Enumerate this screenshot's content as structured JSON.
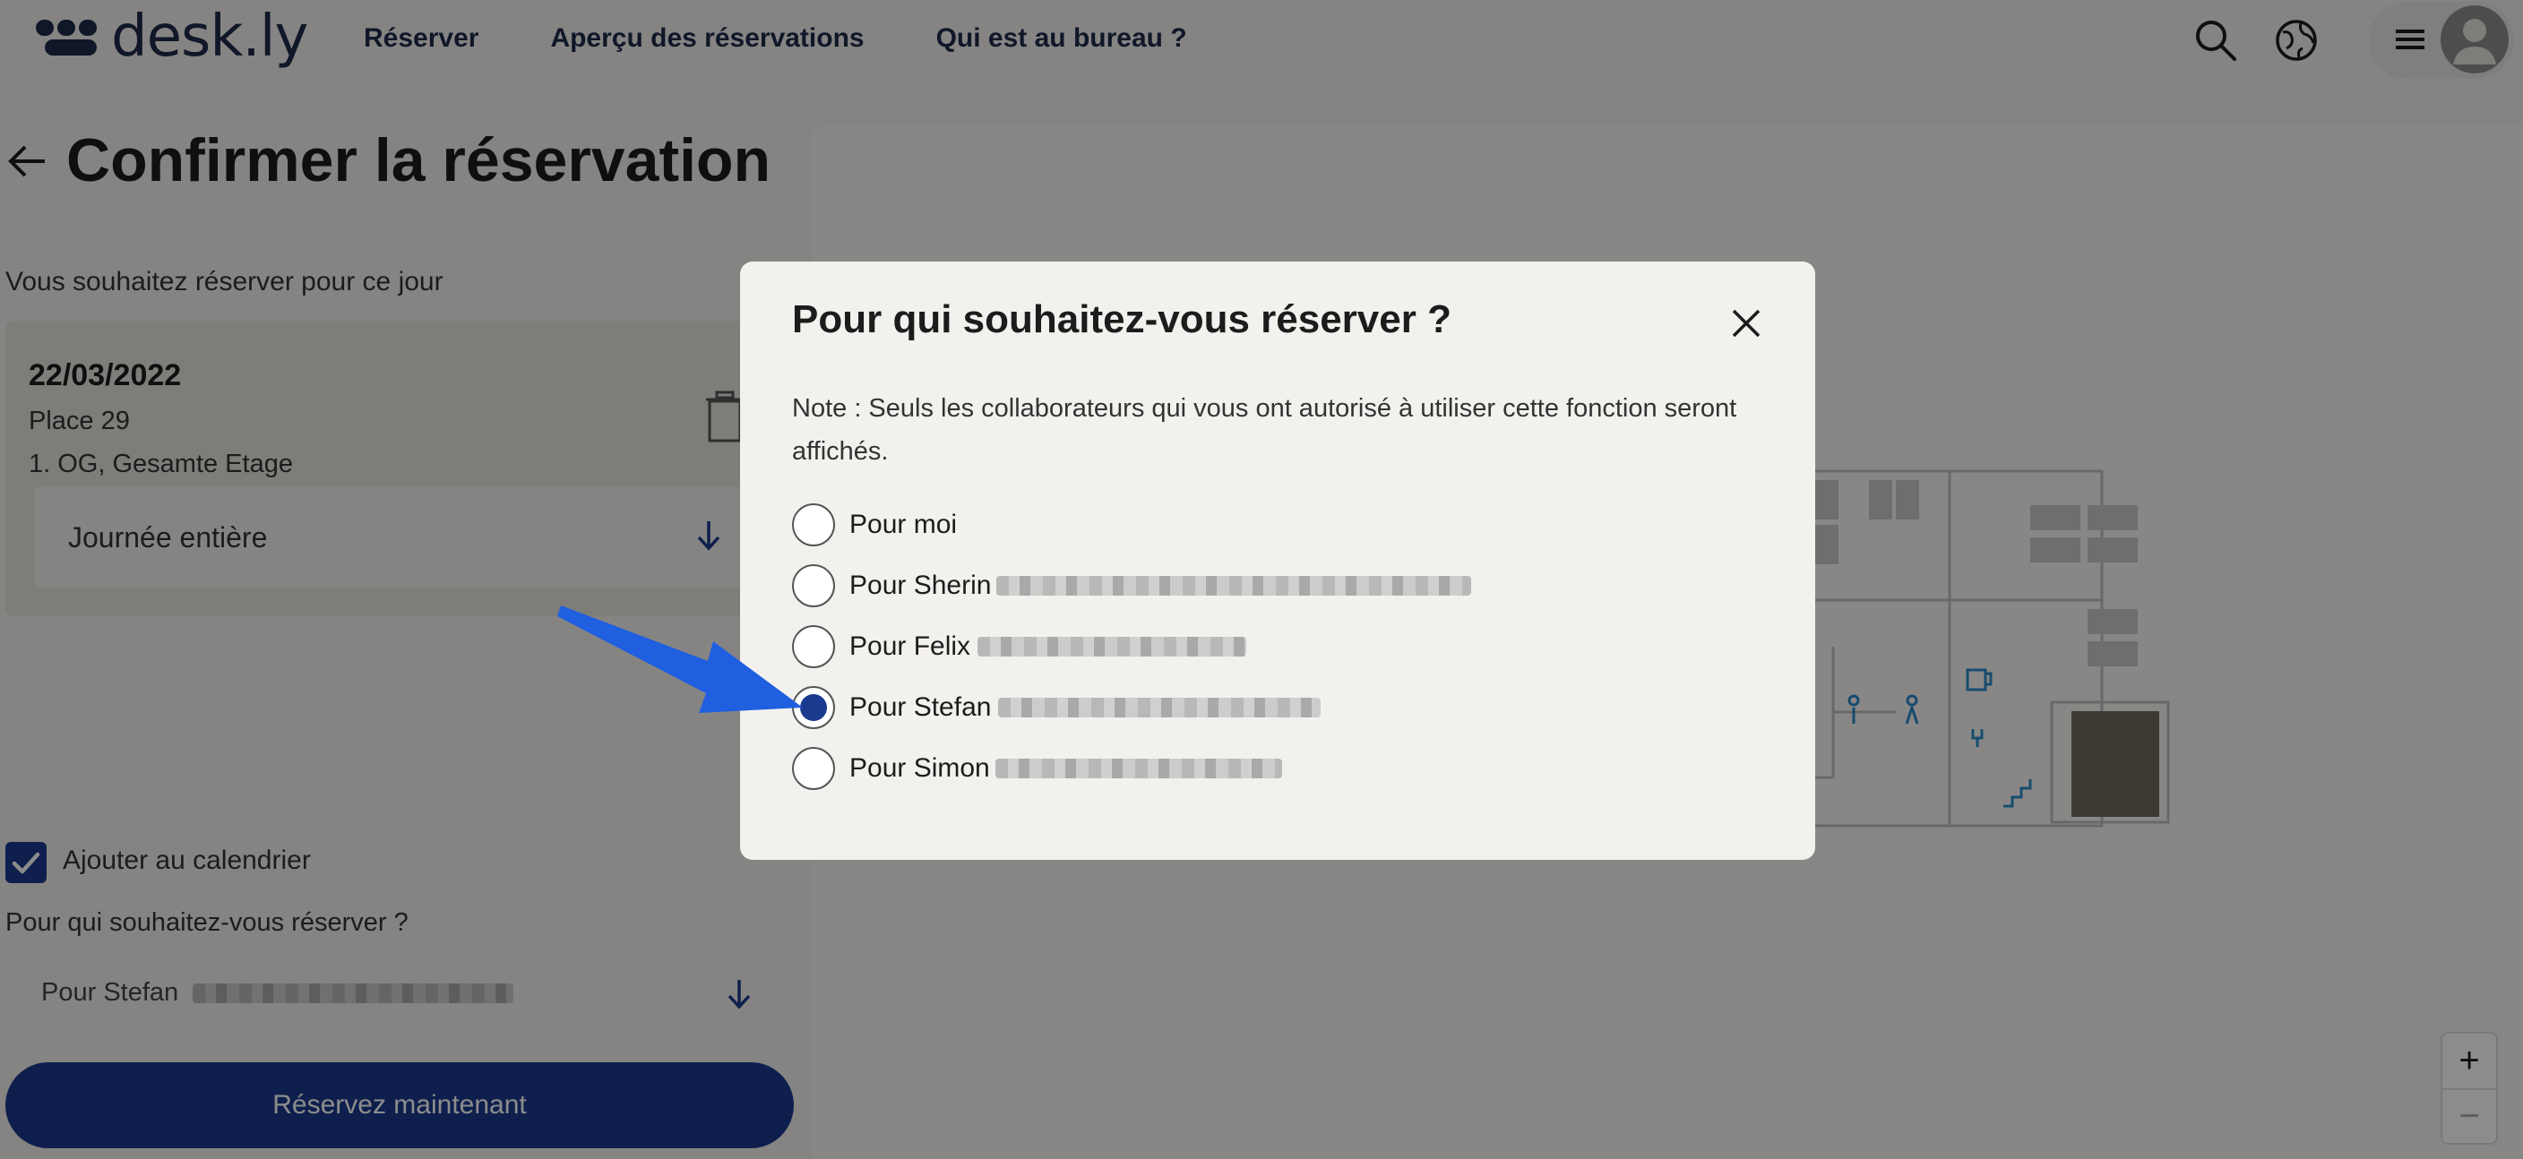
{
  "brand": {
    "name": "desk.ly"
  },
  "nav": [
    "Réserver",
    "Aperçu des réservations",
    "Qui est au bureau ?"
  ],
  "page": {
    "title": "Confirmer la réservation",
    "date_prompt": "Vous souhaitez réserver pour ce jour",
    "booking": {
      "date": "22/03/2022",
      "place": "Place 29",
      "floor": "1. OG, Gesamte Etage",
      "duration": "Journée entière"
    },
    "calendar_label": "Ajouter au calendrier",
    "calendar_checked": true,
    "for_whom_label": "Pour qui souhaitez-vous réserver ?",
    "for_whom_value": "Pour Stefan",
    "reserve_button": "Réservez maintenant"
  },
  "zoom": {
    "plus": "+",
    "minus": "−"
  },
  "modal": {
    "title": "Pour qui souhaitez-vous réserver ?",
    "note": "Note : Seuls les collaborateurs qui vous ont autorisé à utiliser cette fonction seront affichés.",
    "options": [
      {
        "label": "Pour moi",
        "checked": false
      },
      {
        "label": "Pour Sherin",
        "checked": false
      },
      {
        "label": "Pour Felix",
        "checked": false
      },
      {
        "label": "Pour Stefan",
        "checked": true
      },
      {
        "label": "Pour Simon",
        "checked": false
      }
    ]
  },
  "colors": {
    "primary": "#1a3a8f",
    "brand": "#1e2a4a",
    "annotation": "#1f5fe0"
  }
}
